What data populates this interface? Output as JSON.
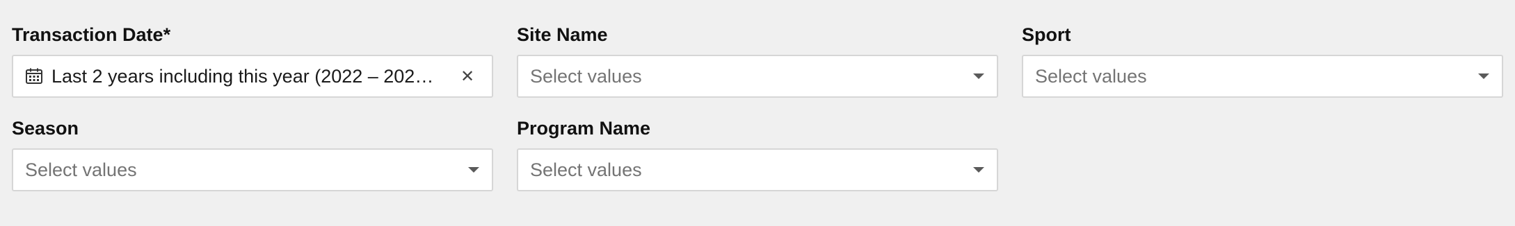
{
  "filters": [
    {
      "label": "Transaction Date*",
      "value": "Last 2 years including this year (2022 – 202…",
      "icon": "calendar-icon",
      "clear_icon": "close-icon",
      "placeholder": ""
    },
    {
      "label": "Site Name",
      "placeholder": "Select values",
      "icon": "chevron-down-icon"
    },
    {
      "label": "Sport",
      "placeholder": "Select values",
      "icon": "chevron-down-icon"
    },
    {
      "label": "Season",
      "placeholder": "Select values",
      "icon": "chevron-down-icon"
    },
    {
      "label": "Program Name",
      "placeholder": "Select values",
      "icon": "chevron-down-icon"
    }
  ],
  "colors": {
    "background": "#f0f0f0",
    "input_border": "#d6d6d6",
    "label_text": "#111111",
    "placeholder_text": "#747474",
    "value_text": "#1a1a1a"
  }
}
